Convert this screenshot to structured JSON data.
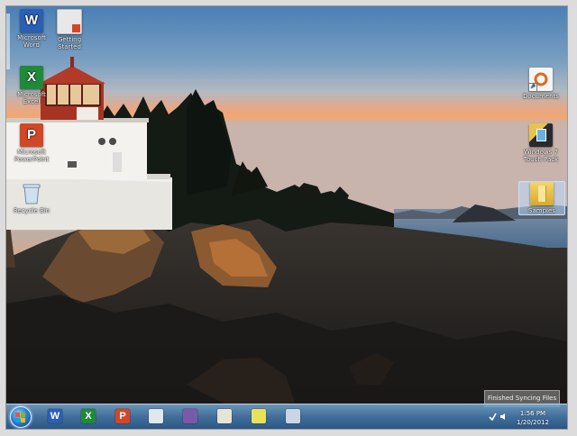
{
  "desktop": {
    "icons": [
      {
        "id": "word",
        "label": "Microsoft Word",
        "icon": "word-icon",
        "color": "#2b5fb4",
        "letter": "W"
      },
      {
        "id": "getting-started",
        "label": "Getting Started",
        "icon": "getting-started-icon",
        "color": "#e8e8e8",
        "letter": ""
      },
      {
        "id": "excel",
        "label": "Microsoft Excel",
        "icon": "excel-icon",
        "color": "#1f8a3a",
        "letter": "X"
      },
      {
        "id": "powerpoint",
        "label": "Microsoft PowerPoint",
        "icon": "powerpoint-icon",
        "color": "#d24726",
        "letter": "P"
      },
      {
        "id": "recycle-bin",
        "label": "Recycle Bin",
        "icon": "recycle-bin-icon",
        "color": "#9fb6c8",
        "letter": ""
      },
      {
        "id": "documents",
        "label": "Documents",
        "icon": "documents-icon",
        "color": "#f5f5f5",
        "letter": ""
      },
      {
        "id": "touch-pack",
        "label": "Windows 7 Touch Pack",
        "icon": "touch-pack-icon",
        "color": "#3b3b3b",
        "letter": ""
      },
      {
        "id": "samples",
        "label": "Samples",
        "icon": "folder-icon",
        "color": "#e9c34a",
        "letter": ""
      }
    ]
  },
  "taskbar": {
    "pinned": [
      {
        "name": "word",
        "icon": "word-icon",
        "color": "#2b5fb4",
        "letter": "W"
      },
      {
        "name": "excel",
        "icon": "excel-icon",
        "color": "#1f8a3a",
        "letter": "X"
      },
      {
        "name": "powerpoint",
        "icon": "powerpoint-icon",
        "color": "#d24726",
        "letter": "P"
      },
      {
        "name": "notes",
        "icon": "pen-icon",
        "color": "#dfe7ef",
        "letter": ""
      },
      {
        "name": "media-center",
        "icon": "media-icon",
        "color": "#7a5aa8",
        "letter": ""
      },
      {
        "name": "paint",
        "icon": "paint-icon",
        "color": "#e7e3d5",
        "letter": ""
      },
      {
        "name": "sticky-notes",
        "icon": "sticky-notes-icon",
        "color": "#e8e25a",
        "letter": ""
      },
      {
        "name": "calculator",
        "icon": "calculator-icon",
        "color": "#c9d6e6",
        "letter": ""
      }
    ],
    "clock_time": "1:56 PM",
    "clock_date": "1/20/2012",
    "notification": "Finished Syncing Files"
  }
}
